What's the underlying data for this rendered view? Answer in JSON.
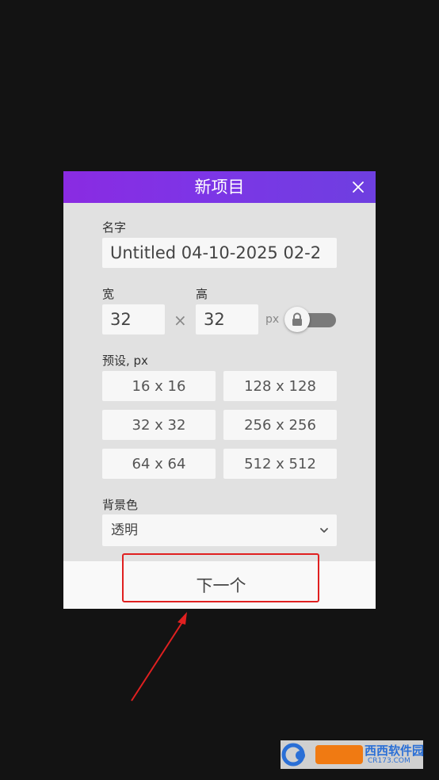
{
  "dialog": {
    "title": "新项目",
    "name_label": "名字",
    "name_value": "Untitled 04-10-2025 02-2",
    "width_label": "宽",
    "height_label": "高",
    "width_value": "32",
    "height_value": "32",
    "times_symbol": "×",
    "unit": "px",
    "aspect_lock": true,
    "presets_label": "预设, px",
    "presets": [
      "16 x 16",
      "128 x 128",
      "32 x 32",
      "256 x 256",
      "64 x 64",
      "512 x 512"
    ],
    "background_label": "背景色",
    "background_value": "透明",
    "next_label": "下一个"
  },
  "watermark": {
    "brand": "西西软件园",
    "site": "CR173.COM"
  },
  "colors": {
    "header_start": "#8a2be2",
    "header_end": "#6e3fe0",
    "annotation": "#e02020",
    "background": "#131313"
  }
}
